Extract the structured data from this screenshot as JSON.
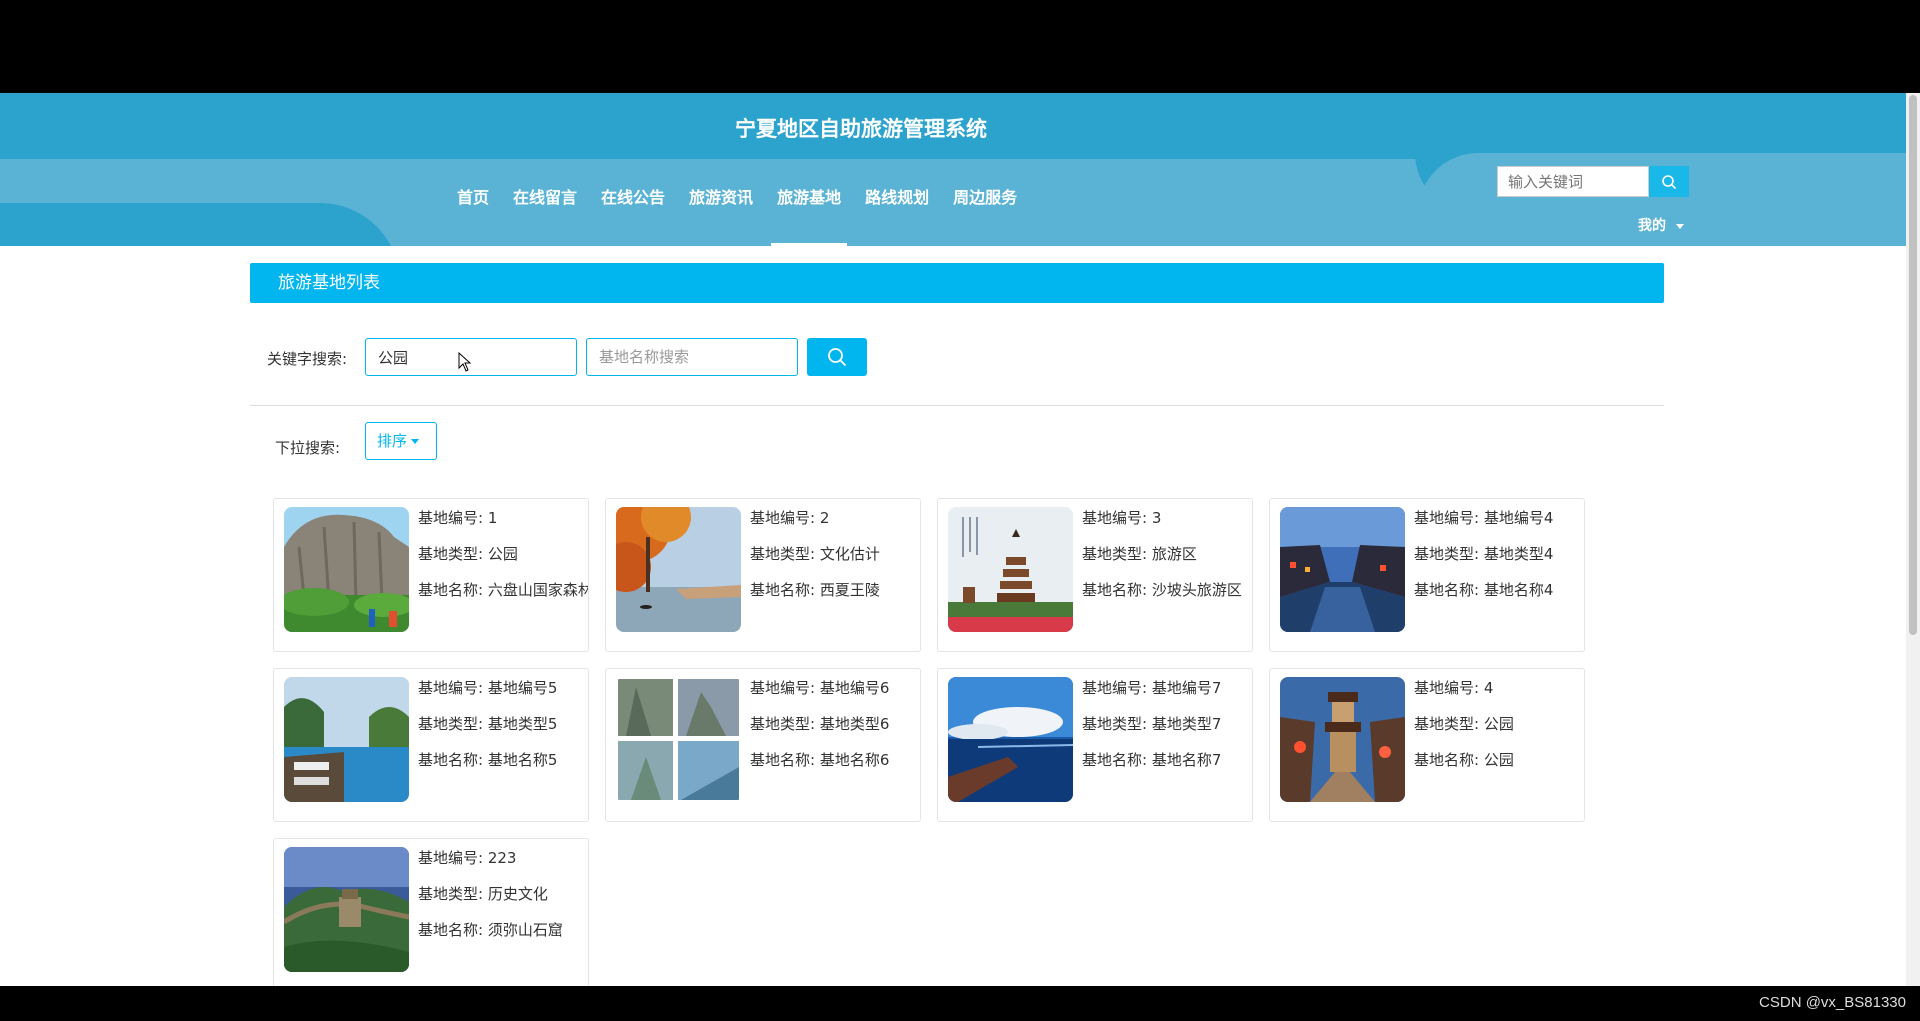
{
  "header": {
    "title": "宁夏地区自助旅游管理系统",
    "nav": [
      "首页",
      "在线留言",
      "在线公告",
      "旅游资讯",
      "旅游基地",
      "路线规划",
      "周边服务"
    ],
    "active_nav": "旅游基地",
    "search_placeholder": "输入关键词",
    "user_menu": "我的"
  },
  "list": {
    "title": "旅游基地列表",
    "keyword_label": "关键字搜索:",
    "keyword_value": "公园",
    "name_placeholder": "基地名称搜索",
    "dropdown_label": "下拉搜索:",
    "sort_label": "排序"
  },
  "cards": [
    {
      "no_label": "基地编号:",
      "no": "1",
      "type_label": "基地类型:",
      "type": "公园",
      "name_label": "基地名称:",
      "name": "六盘山国家森林公园",
      "image": "cliff-park"
    },
    {
      "no_label": "基地编号:",
      "no": "2",
      "type_label": "基地类型:",
      "type": "文化估计",
      "name_label": "基地名称:",
      "name": "西夏王陵",
      "image": "autumn-lake"
    },
    {
      "no_label": "基地编号:",
      "no": "3",
      "type_label": "基地类型:",
      "type": "旅游区",
      "name_label": "基地名称:",
      "name": "沙坡头旅游区",
      "image": "pagoda"
    },
    {
      "no_label": "基地编号:",
      "no": "基地编号4",
      "type_label": "基地类型:",
      "type": "基地类型4",
      "name_label": "基地名称:",
      "name": "基地名称4",
      "image": "water-town-night"
    },
    {
      "no_label": "基地编号:",
      "no": "基地编号5",
      "type_label": "基地类型:",
      "type": "基地类型5",
      "name_label": "基地名称:",
      "name": "基地名称5",
      "image": "resort-pool"
    },
    {
      "no_label": "基地编号:",
      "no": "基地编号6",
      "type_label": "基地类型:",
      "type": "基地类型6",
      "name_label": "基地名称:",
      "name": "基地名称6",
      "image": "mountain-collage"
    },
    {
      "no_label": "基地编号:",
      "no": "基地编号7",
      "type_label": "基地类型:",
      "type": "基地类型7",
      "name_label": "基地名称:",
      "name": "基地名称7",
      "image": "sea-sky"
    },
    {
      "no_label": "基地编号:",
      "no": "4",
      "type_label": "基地类型:",
      "type": "公园",
      "name_label": "基地名称:",
      "name": "公园",
      "image": "ancient-street"
    },
    {
      "no_label": "基地编号:",
      "no": "223",
      "type_label": "基地类型:",
      "type": "历史文化",
      "name_label": "基地名称:",
      "name": "须弥山石窟",
      "image": "great-wall"
    }
  ],
  "watermark": "CSDN @vx_BS81330"
}
